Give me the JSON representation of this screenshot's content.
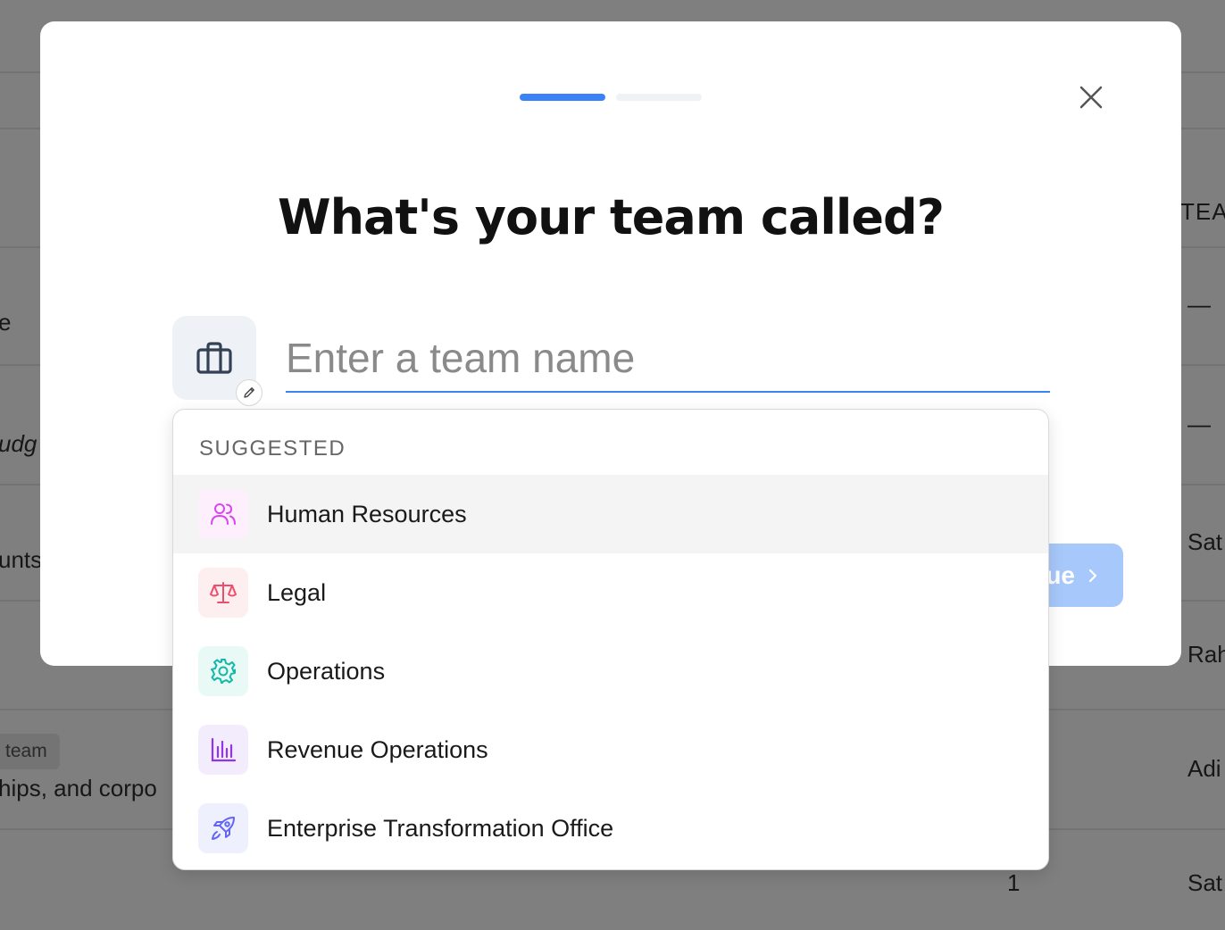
{
  "modal": {
    "title": "What's your team called?",
    "progress": {
      "steps": 2,
      "current": 1
    },
    "input": {
      "placeholder": "Enter a team name",
      "value": ""
    },
    "continue_label": "Continue",
    "close_icon": "close-icon",
    "team_icon": "briefcase-icon",
    "edit_icon": "pencil-icon"
  },
  "suggestions": {
    "header": "SUGGESTED",
    "items": [
      {
        "label": "Human Resources",
        "icon": "users-icon",
        "color": "#d946ef",
        "bg": "#fdf0fc"
      },
      {
        "label": "Legal",
        "icon": "scale-icon",
        "color": "#ef4d6b",
        "bg": "#fdeef0"
      },
      {
        "label": "Operations",
        "icon": "gear-icon",
        "color": "#14b8a6",
        "bg": "#e9faf6"
      },
      {
        "label": "Revenue Operations",
        "icon": "bar-chart-icon",
        "color": "#9333ea",
        "bg": "#f3ecfd"
      },
      {
        "label": "Enterprise Transformation Office",
        "icon": "rocket-icon",
        "color": "#6366f1",
        "bg": "#eef0fe"
      }
    ]
  },
  "background": {
    "header_fragment": "TEA",
    "left_fragments": [
      "e",
      "udg",
      "unts",
      "hips, and corpo"
    ],
    "badge": "team",
    "right_fragments": [
      "—",
      "—",
      "Sat",
      "Rah",
      "Adi",
      "Sat"
    ],
    "count": "1"
  },
  "colors": {
    "accent": "#3b82f6",
    "accent_disabled": "#a7c8fa"
  }
}
